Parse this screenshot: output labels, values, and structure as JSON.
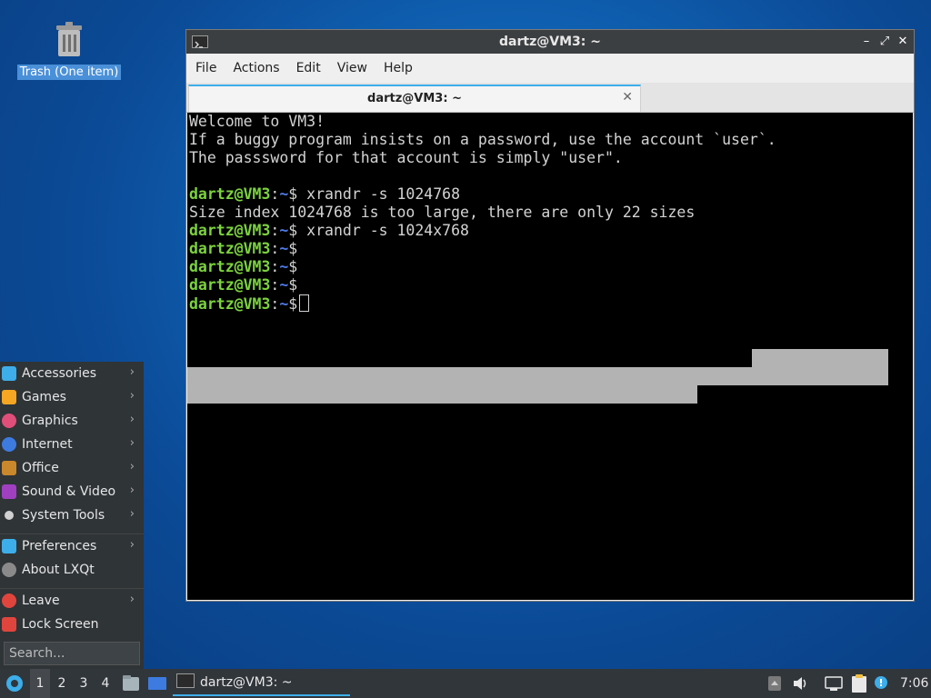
{
  "desktop": {
    "trash_label": "Trash (One item)"
  },
  "window": {
    "title": "dartz@VM3: ~",
    "controls": {
      "minimize": "–",
      "maximize": "⤢",
      "close": "✕"
    },
    "menu": [
      "File",
      "Actions",
      "Edit",
      "View",
      "Help"
    ],
    "tab_title": "dartz@VM3: ~",
    "tab_close": "✕"
  },
  "terminal": {
    "motd": [
      "Welcome to VM3!",
      "If a buggy program insists on a password, use the account `user`.",
      "The passsword for that account is simply \"user\"."
    ],
    "prompt_user": "dartz@VM3",
    "prompt_path": "~",
    "prompt_sep": ":",
    "prompt_sym": "$",
    "commands": [
      {
        "cmd": " xrandr -s 1024768",
        "output": "Size index 1024768 is too large, there are only 22 sizes"
      },
      {
        "cmd": " xrandr -s 1024x768",
        "output": ""
      },
      {
        "cmd": "",
        "output": ""
      },
      {
        "cmd": "",
        "output": ""
      },
      {
        "cmd": "",
        "output": ""
      },
      {
        "cmd": " ",
        "output": ""
      }
    ]
  },
  "start_menu": {
    "items": [
      {
        "label": "Accessories",
        "icon": "accessories-icon",
        "color": "#3daee9",
        "submenu": true
      },
      {
        "label": "Games",
        "icon": "games-icon",
        "color": "#f5a623",
        "submenu": true
      },
      {
        "label": "Graphics",
        "icon": "graphics-icon",
        "color": "#e04e7a",
        "submenu": true
      },
      {
        "label": "Internet",
        "icon": "internet-icon",
        "color": "#3d7be0",
        "submenu": true
      },
      {
        "label": "Office",
        "icon": "office-icon",
        "color": "#c9882c",
        "submenu": true
      },
      {
        "label": "Sound & Video",
        "icon": "sound-video-icon",
        "color": "#a040c0",
        "submenu": true
      },
      {
        "label": "System Tools",
        "icon": "system-tools-icon",
        "color": "#d0d0d0",
        "submenu": true
      },
      {
        "label": "Preferences",
        "icon": "preferences-icon",
        "color": "#3daee9",
        "submenu": true
      },
      {
        "label": "About LXQt",
        "icon": "info-icon",
        "color": "#8a8a8a",
        "submenu": false
      },
      {
        "label": "Leave",
        "icon": "power-icon",
        "color": "#e0453d",
        "submenu": true
      },
      {
        "label": "Lock Screen",
        "icon": "lock-icon",
        "color": "#e0453d",
        "submenu": false
      }
    ],
    "search_placeholder": "Search..."
  },
  "panel": {
    "desktops": [
      "1",
      "2",
      "3",
      "4"
    ],
    "task_label": "dartz@VM3: ~",
    "clock": "7:06"
  }
}
